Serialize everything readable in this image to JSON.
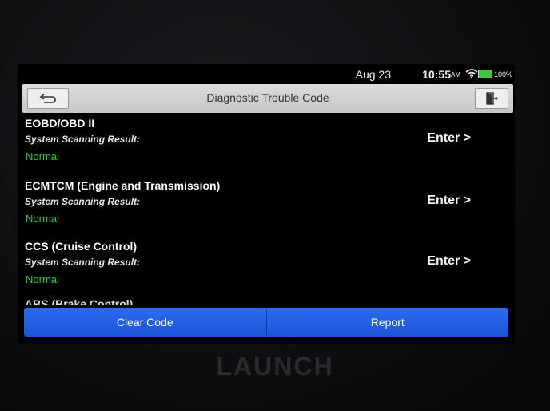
{
  "status_bar": {
    "date": "Aug 23",
    "time": "10:55",
    "ampm": "AM",
    "battery": "100%",
    "icons": [
      "wifi-icon",
      "battery-icon"
    ]
  },
  "header": {
    "title": "Diagnostic Trouble Code",
    "back_icon": "back-arrow-icon",
    "exit_icon": "exit-icon"
  },
  "systems": [
    {
      "name": "EOBD/OBD II",
      "subtitle": "System Scanning Result:",
      "status": "Normal",
      "action": "Enter >"
    },
    {
      "name": "ECMTCM (Engine and Transmission)",
      "subtitle": "System Scanning Result:",
      "status": "Normal",
      "action": "Enter >"
    },
    {
      "name": "CCS (Cruise Control)",
      "subtitle": "System Scanning Result:",
      "status": "Normal",
      "action": "Enter >"
    }
  ],
  "partial_row": "ABS (Brake Control)",
  "buttons": {
    "clear_code": "Clear Code",
    "report": "Report"
  },
  "brand": "LAUNCH",
  "colors": {
    "accent_blue": "#2563eb",
    "status_green": "#34c735",
    "header_gray": "#d0d0d0"
  }
}
